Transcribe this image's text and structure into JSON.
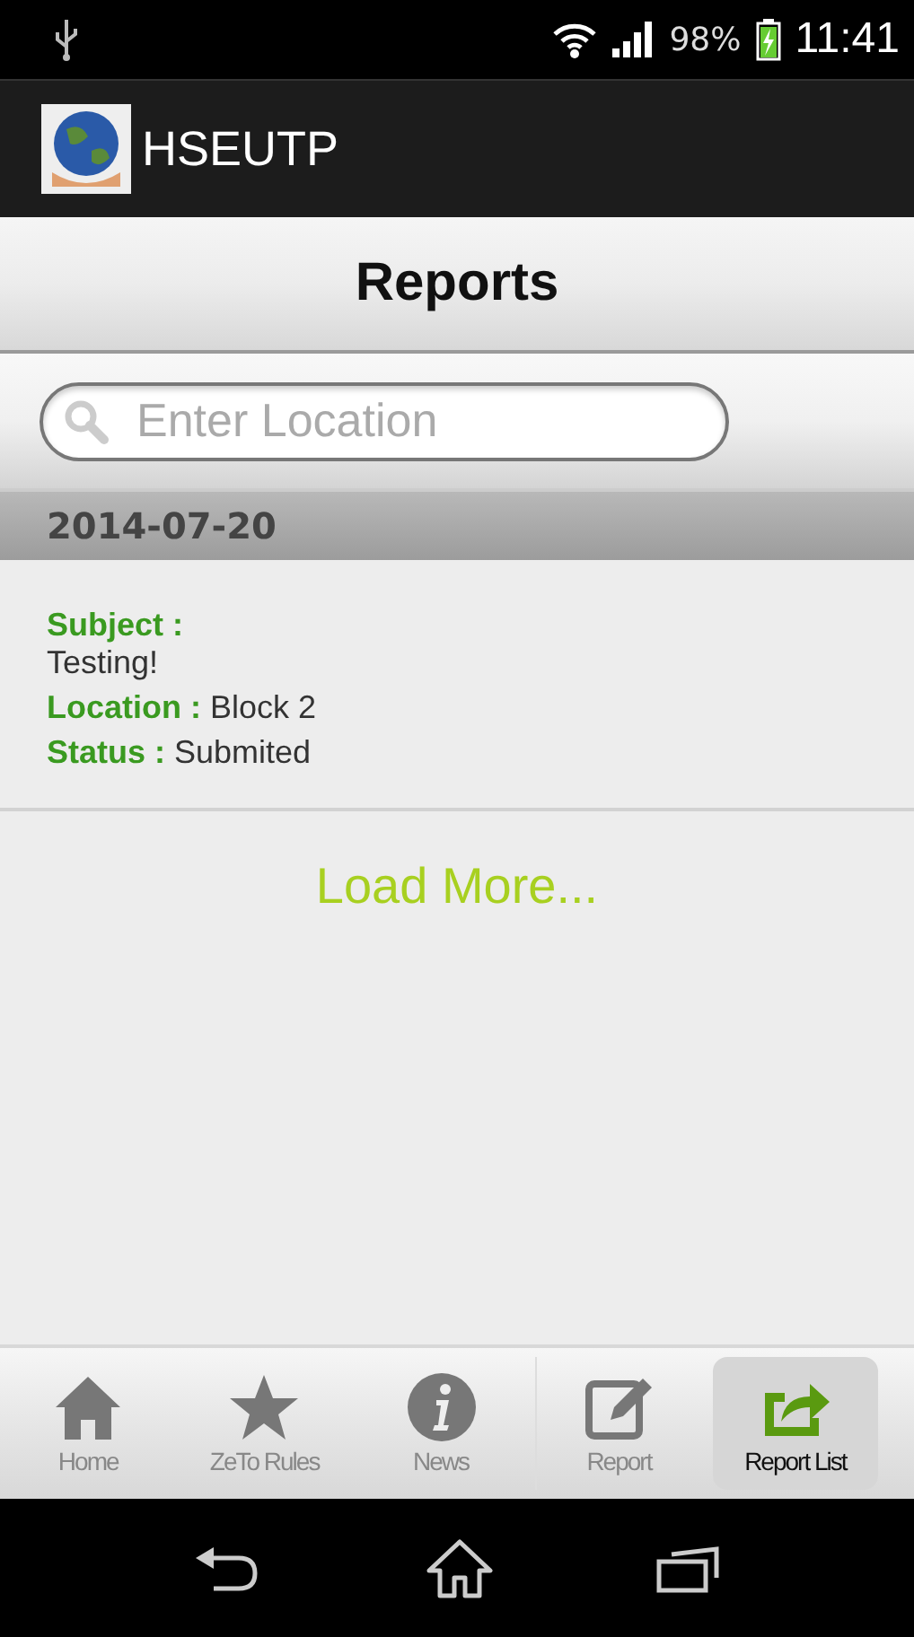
{
  "status_bar": {
    "battery": "98%",
    "time": "11:41"
  },
  "app_bar": {
    "title": "HSEUTP"
  },
  "header": {
    "title": "Reports"
  },
  "search": {
    "placeholder": "Enter Location"
  },
  "date_heading": "2014-07-20",
  "report": {
    "fields": [
      {
        "label": "Subject :",
        "value": "Testing!",
        "kind": "stacked"
      },
      {
        "label": "Location :",
        "value": "Block 2",
        "kind": "inline"
      },
      {
        "label": "Status :",
        "value": "Submited",
        "kind": "inline"
      }
    ]
  },
  "load_more": "Load More...",
  "tabs": [
    {
      "label": "Home",
      "kind": "home",
      "selected": false
    },
    {
      "label": "ZeTo Rules",
      "kind": "star",
      "selected": false
    },
    {
      "label": "News",
      "kind": "info",
      "selected": false
    },
    {
      "label": "Report",
      "kind": "edit",
      "selected": false
    },
    {
      "label": "Report List",
      "kind": "share",
      "selected": true
    }
  ]
}
